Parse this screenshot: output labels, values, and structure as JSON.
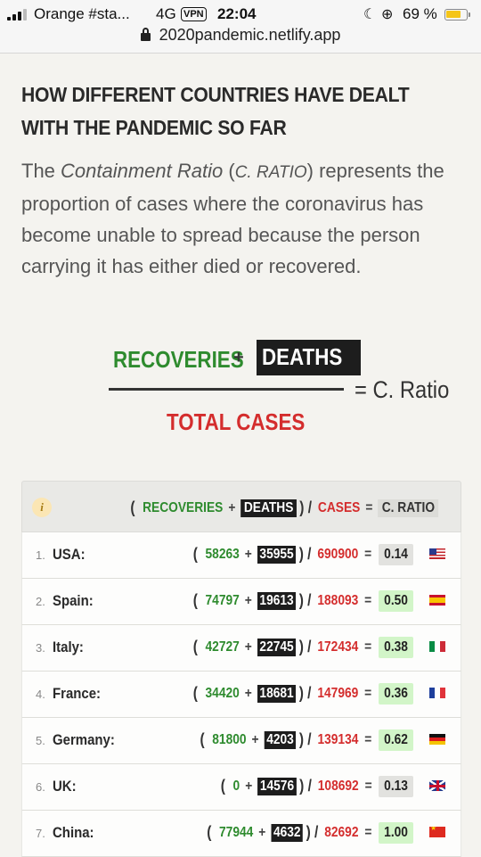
{
  "status_bar": {
    "carrier": "Orange #sta...",
    "network": "4G",
    "vpn": "VPN",
    "time": "22:04",
    "battery": "69 %"
  },
  "url_bar": {
    "domain": "2020pandemic.netlify.app"
  },
  "article": {
    "heading": "HOW DIFFERENT COUNTRIES HAVE DEALT WITH THE PANDEMIC SO FAR",
    "desc_before": "The ",
    "desc_term": "Containment Ratio",
    "desc_mid": " (",
    "desc_abbr": "C. RATIO",
    "desc_after": ") represents the proportion of cases where the coronavirus has become unable to spread because the person carrying it has either died or recovered."
  },
  "formula": {
    "recoveries": "RECOVERIES",
    "plus": "+",
    "deaths": "DEATHS",
    "equals_ratio": "= C. Ratio",
    "total_cases": "TOTAL CASES"
  },
  "table": {
    "header": {
      "info": "i",
      "open_paren": "(",
      "recoveries": "RECOVERIES",
      "plus": "+",
      "deaths": "DEATHS",
      "close_slash": ") /",
      "cases": "CASES",
      "equals": "=",
      "ratio": "C. RATIO"
    },
    "rows": [
      {
        "rank": "1.",
        "country": "USA:",
        "recoveries": "58263",
        "deaths": "35955",
        "cases": "690900",
        "ratio": "0.14",
        "flag": "usa"
      },
      {
        "rank": "2.",
        "country": "Spain:",
        "recoveries": "74797",
        "deaths": "19613",
        "cases": "188093",
        "ratio": "0.50",
        "flag": "spain"
      },
      {
        "rank": "3.",
        "country": "Italy:",
        "recoveries": "42727",
        "deaths": "22745",
        "cases": "172434",
        "ratio": "0.38",
        "flag": "italy"
      },
      {
        "rank": "4.",
        "country": "France:",
        "recoveries": "34420",
        "deaths": "18681",
        "cases": "147969",
        "ratio": "0.36",
        "flag": "france"
      },
      {
        "rank": "5.",
        "country": "Germany:",
        "recoveries": "81800",
        "deaths": "4203",
        "cases": "139134",
        "ratio": "0.62",
        "flag": "germany"
      },
      {
        "rank": "6.",
        "country": "UK:",
        "recoveries": "0",
        "deaths": "14576",
        "cases": "108692",
        "ratio": "0.13",
        "flag": "uk"
      },
      {
        "rank": "7.",
        "country": "China:",
        "recoveries": "77944",
        "deaths": "4632",
        "cases": "82692",
        "ratio": "1.00",
        "flag": "china"
      }
    ],
    "row_syntax": {
      "open_paren": "(",
      "plus": "+",
      "close_slash": ") /",
      "equals": "="
    },
    "colors": {
      "green": "#2e8b2e",
      "red": "#d42d2d",
      "ratio_high_bg": "#d2f5c8",
      "ratio_low_bg": "#e2e2df"
    }
  }
}
